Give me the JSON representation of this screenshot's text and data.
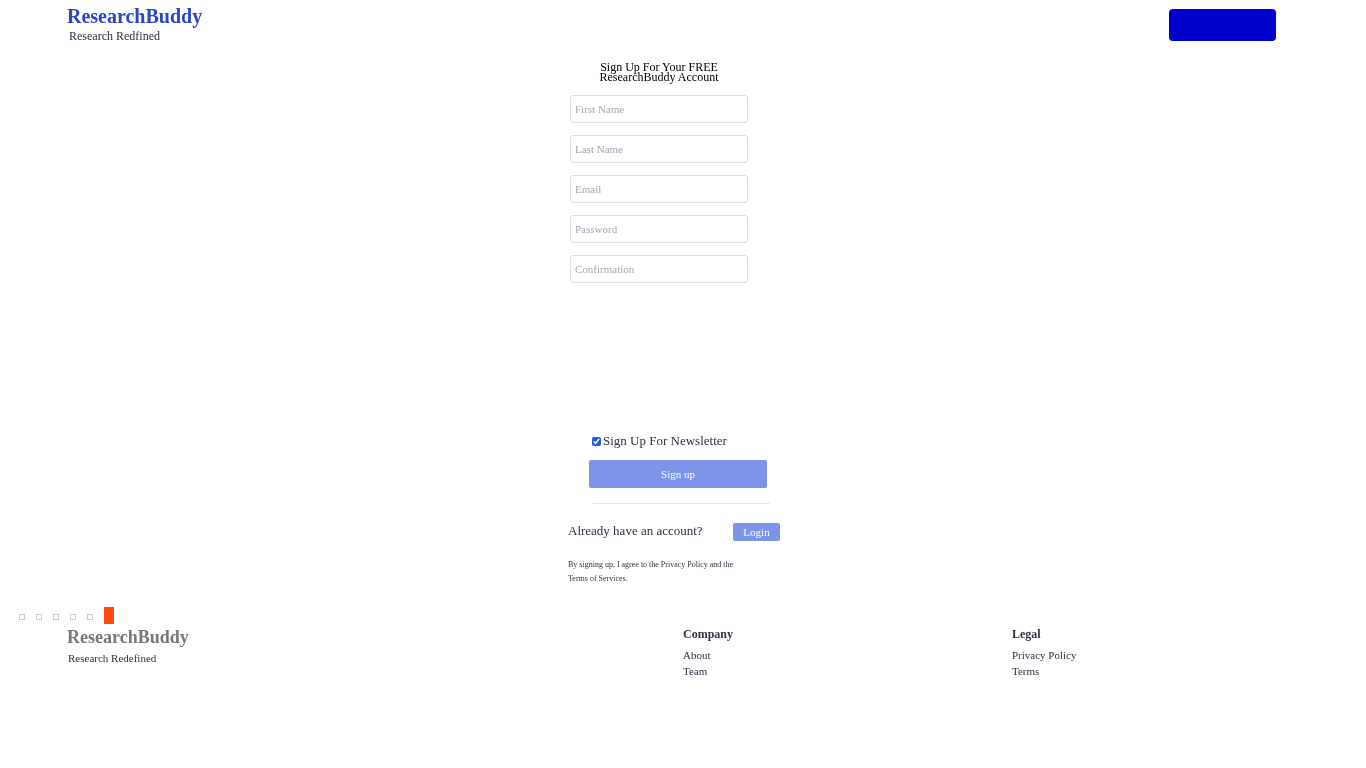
{
  "header": {
    "logo": "ResearchBuddy",
    "tagline": "Research Redfined"
  },
  "form": {
    "title": "Sign Up For Your FREE ResearchBuddy Account",
    "fields": [
      {
        "placeholder": "First Name"
      },
      {
        "placeholder": "Last Name"
      },
      {
        "placeholder": "Email"
      },
      {
        "placeholder": "Password"
      },
      {
        "placeholder": "Confirmation"
      }
    ],
    "newsletter": {
      "label": "Sign Up For Newsletter",
      "checked": true
    },
    "submit": "Sign up",
    "login_prompt": "Already have an account?",
    "login": "Login",
    "terms": "By signing up, I agree to the Privacy Policy and the Terms of Services."
  },
  "pager": [
    {
      "selected": false
    },
    {
      "selected": false
    },
    {
      "selected": false
    },
    {
      "selected": false
    },
    {
      "selected": false
    },
    {
      "selected": true
    }
  ],
  "footer": {
    "logo": "ResearchBuddy",
    "tagline": "Research Redefined",
    "columns": [
      {
        "heading": "Company",
        "links": [
          "About",
          "Team"
        ]
      },
      {
        "heading": "Legal",
        "links": [
          "Privacy Policy",
          "Terms"
        ]
      }
    ]
  }
}
